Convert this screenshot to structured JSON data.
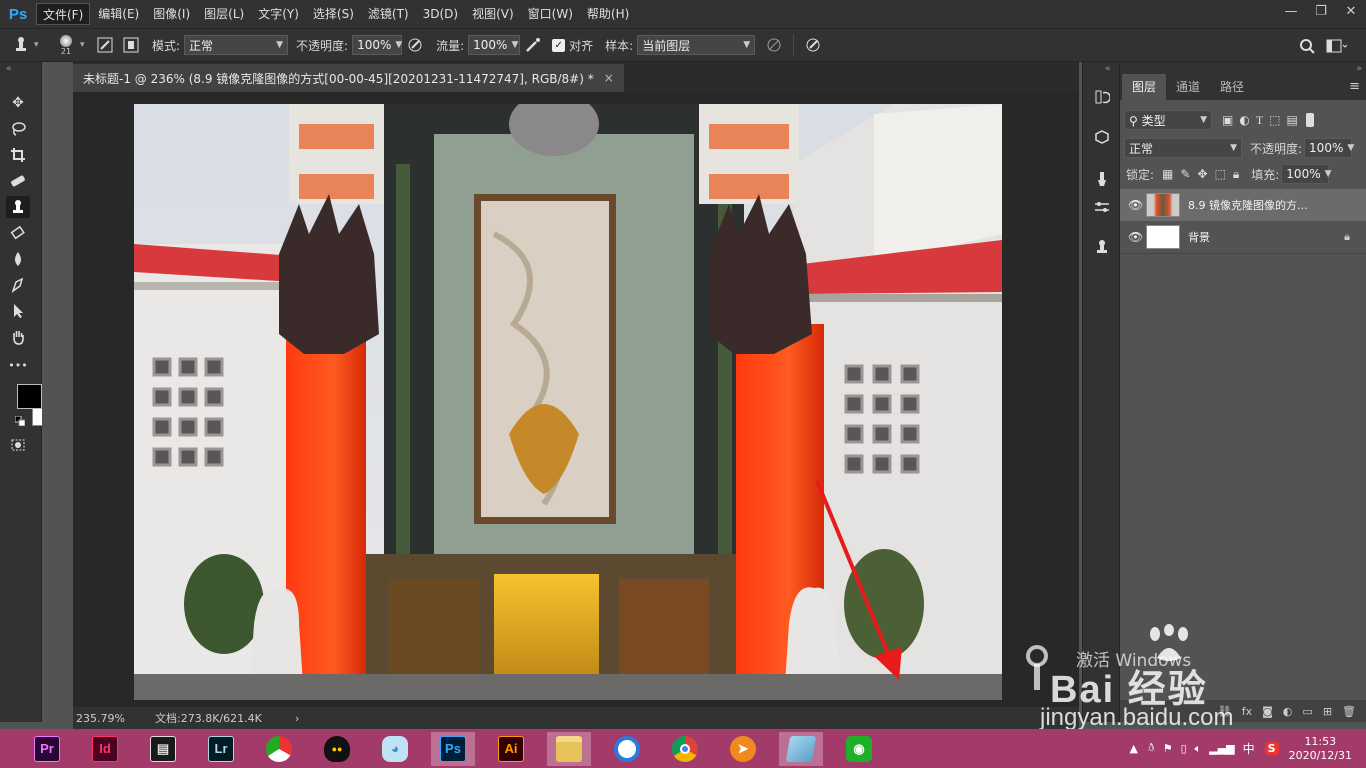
{
  "menubar": {
    "logo": "Ps",
    "items": [
      {
        "label": "文件(F)"
      },
      {
        "label": "编辑(E)"
      },
      {
        "label": "图像(I)"
      },
      {
        "label": "图层(L)"
      },
      {
        "label": "文字(Y)"
      },
      {
        "label": "选择(S)"
      },
      {
        "label": "滤镜(T)"
      },
      {
        "label": "3D(D)"
      },
      {
        "label": "视图(V)"
      },
      {
        "label": "窗口(W)"
      },
      {
        "label": "帮助(H)"
      }
    ],
    "window_buttons": {
      "minimize": "—",
      "restore": "❐",
      "close": "✕"
    }
  },
  "options": {
    "brush_size": "21",
    "mode_label": "模式:",
    "mode_value": "正常",
    "opacity_label": "不透明度:",
    "opacity_value": "100%",
    "flow_label": "流量:",
    "flow_value": "100%",
    "aligned_label": "对齐",
    "sample_label": "样本:",
    "sample_value": "当前图层"
  },
  "document": {
    "tab_title": "未标题-1 @ 236% (8.9 镜像克隆图像的方式[00-00-45][20201231-11472747], RGB/8#) *",
    "close": "×",
    "zoom": "235.79%",
    "doc_size": "文档:273.8K/621.4K",
    "arrow": "›"
  },
  "toolbox": {
    "more": "•••",
    "expand": "«"
  },
  "layers": {
    "tabs": [
      {
        "label": "图层"
      },
      {
        "label": "通道"
      },
      {
        "label": "路径"
      }
    ],
    "filter_label": "类型",
    "blend_mode": "正常",
    "opacity_label": "不透明度:",
    "opacity_value": "100%",
    "lock_label": "锁定:",
    "fill_label": "填充:",
    "fill_value": "100%",
    "items": [
      {
        "name": "8.9 镜像克隆图像的方..."
      },
      {
        "name": "背景"
      }
    ]
  },
  "taskbar": {
    "apps": [
      {
        "label": "Pr",
        "color": "#ea77ff",
        "bg": "#2a0634"
      },
      {
        "label": "Id",
        "color": "#ff3366",
        "bg": "#49021f"
      },
      {
        "label": "",
        "icon": "film-icon"
      },
      {
        "label": "Lr",
        "color": "#add5ec",
        "bg": "#001d26"
      },
      {
        "label": "",
        "icon": "pinwheel-icon"
      },
      {
        "label": "",
        "icon": "qq-penguin-icon"
      },
      {
        "label": "",
        "icon": "chat-bubble-icon"
      },
      {
        "label": "Ps",
        "color": "#31a8ff",
        "bg": "#001e36"
      },
      {
        "label": "Ai",
        "color": "#ff9a00",
        "bg": "#330000"
      },
      {
        "label": "",
        "icon": "folder-icon"
      },
      {
        "label": "",
        "icon": "browser-icon"
      },
      {
        "label": "",
        "icon": "chrome-icon"
      },
      {
        "label": "",
        "icon": "media-player-icon"
      },
      {
        "label": "",
        "icon": "notepad-icon"
      },
      {
        "label": "",
        "icon": "wifi-share-icon"
      }
    ],
    "ime": "中",
    "ime_s": "S",
    "time": "11:53",
    "date": "2020/12/31"
  },
  "watermark": {
    "line1": "激活 Windows",
    "brand": "Bai  经验",
    "url": "jingyan.baidu.com"
  }
}
